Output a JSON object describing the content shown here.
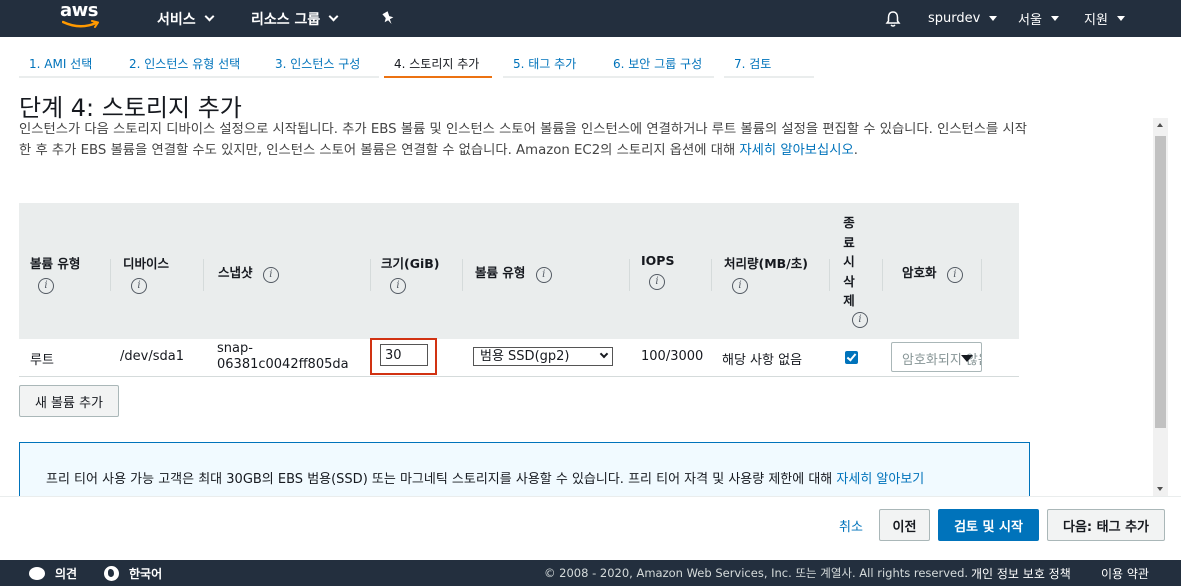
{
  "topnav": {
    "logo_text": "aws",
    "services": "서비스",
    "resource_groups": "리소스 그룹",
    "user": "spurdev",
    "region": "서울",
    "support": "지원"
  },
  "steps": [
    {
      "label": "1. AMI 선택"
    },
    {
      "label": "2. 인스턴스 유형 선택"
    },
    {
      "label": "3. 인스턴스 구성"
    },
    {
      "label": "4. 스토리지 추가"
    },
    {
      "label": "5. 태그 추가"
    },
    {
      "label": "6. 보안 그룹 구성"
    },
    {
      "label": "7. 검토"
    }
  ],
  "page": {
    "title": "단계 4: 스토리지 추가",
    "description": "인스턴스가 다음 스토리지 디바이스 설정으로 시작됩니다. 추가 EBS 볼륨 및 인스턴스 스토어 볼륨을 인스턴스에 연결하거나 루트 볼륨의 설정을 편집할 수 있습니다. 인스턴스를 시작한 후 추가 EBS 볼륨을 연결할 수도 있지만, 인스턴스 스토어 볼륨은 연결할 수 없습니다. Amazon EC2의 스토리지 옵션에 대해 ",
    "learn_more": "자세히 알아보십시오",
    "period": "."
  },
  "table": {
    "headers": {
      "volume_type": "볼륨 유형",
      "device": "디바이스",
      "snapshot": "스냅샷",
      "size": "크기(GiB)",
      "volume_kind": "볼륨 유형",
      "iops": "IOPS",
      "throughput": "처리량(MB/초)",
      "delete_on_termination": [
        "종",
        "료",
        "시",
        "삭",
        "제"
      ],
      "encryption": "암호화"
    },
    "row": {
      "volume_type": "루트",
      "device": "/dev/sda1",
      "snapshot_line1": "snap-",
      "snapshot_line2": "06381c0042ff805da",
      "size": "30",
      "volume_kind": "범용 SSD(gp2)",
      "iops": "100/3000",
      "throughput": "해당 사항 없음",
      "delete_on_termination": true,
      "encryption": "암호화되지 않음"
    }
  },
  "add_volume_button": "새 볼륨 추가",
  "infobox": {
    "text": "프리 티어 사용 가능 고객은 최대 30GB의 EBS 범용(SSD) 또는 마그네틱 스토리지를 사용할 수 있습니다. 프리 티어 자격 및 사용량 제한에 대해 ",
    "link": "자세히 알아보기"
  },
  "actions": {
    "cancel": "취소",
    "previous": "이전",
    "review_launch": "검토 및 시작",
    "next": "다음: 태그 추가"
  },
  "footer": {
    "feedback": "의견",
    "language": "한국어",
    "copyright": "© 2008 - 2020, Amazon Web Services, Inc. 또는 계열사. All rights reserved.",
    "privacy": "개인 정보 보호 정책",
    "terms": "이용 약관"
  },
  "colors": {
    "nav_bg": "#232f3e",
    "link": "#0073bb",
    "active_tab": "#ec7211",
    "highlight": "#d13212"
  }
}
